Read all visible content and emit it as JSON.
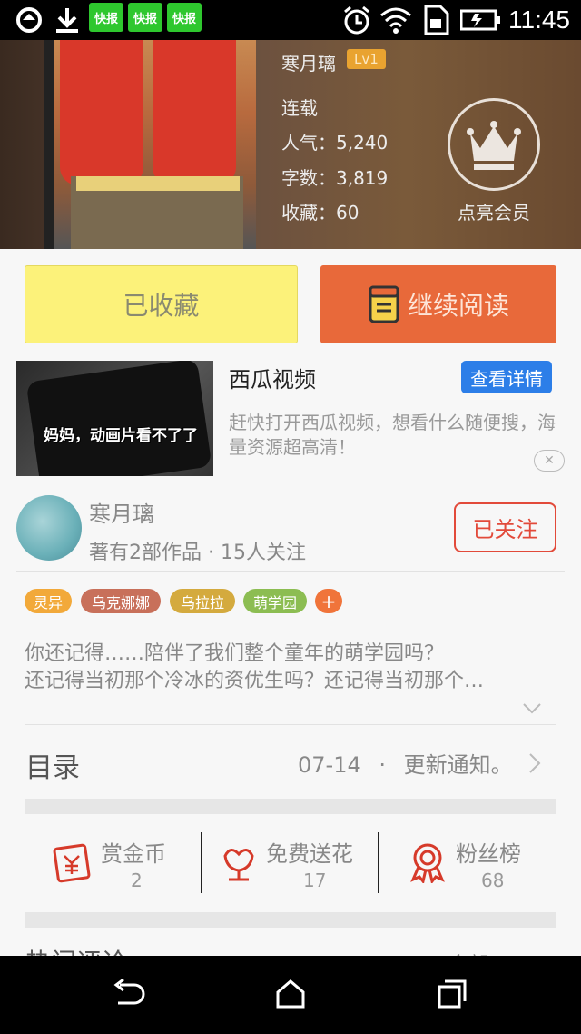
{
  "status_bar": {
    "time": "11:45",
    "app_badges": [
      "快报",
      "快报",
      "快报"
    ]
  },
  "hero": {
    "author_name": "寒月璃",
    "level": "Lv1",
    "status": "连载",
    "popularity": "人气：5,240",
    "word_count": "字数：3,819",
    "favorites": "收藏：60",
    "vip_label": "点亮会员"
  },
  "actions": {
    "favorited_label": "已收藏",
    "continue_label": "继续阅读"
  },
  "ad": {
    "image_caption": "妈妈，动画片看不了了",
    "title": "西瓜视频",
    "details_button": "查看详情",
    "description": "赶快打开西瓜视频，想看什么随便搜，海量资源超高清！",
    "close_icon": "✕"
  },
  "author": {
    "name": "寒月璃",
    "meta": "著有2部作品 · 15人关注",
    "follow_label": "已关注"
  },
  "tags": [
    {
      "label": "灵异",
      "color": "#f2a93a"
    },
    {
      "label": "乌克娜娜",
      "color": "#c8705a"
    },
    {
      "label": "乌拉拉",
      "color": "#d4aa3e"
    },
    {
      "label": "萌学园",
      "color": "#8cbd52"
    },
    {
      "label": "+",
      "color": "#f0743a"
    }
  ],
  "description": {
    "line1": "你还记得……陪伴了我们整个童年的萌学园吗？",
    "line2": "还记得当初那个冷冰的资优生吗？还记得当初那个…"
  },
  "toc": {
    "label": "目录",
    "update_date": "07-14",
    "update_text": "更新通知。"
  },
  "stats": {
    "reward": {
      "label": "赏金币",
      "value": "2"
    },
    "flowers": {
      "label": "免费送花",
      "value": "17"
    },
    "fans": {
      "label": "粉丝榜",
      "value": "68"
    }
  },
  "hot_comments": {
    "label": "热门评论",
    "right": "全部"
  },
  "colors": {
    "accent_orange": "#e8693a",
    "accent_red": "#e24a3a",
    "fav_yellow": "#fcf27a",
    "ad_blue": "#2c7ee8"
  }
}
